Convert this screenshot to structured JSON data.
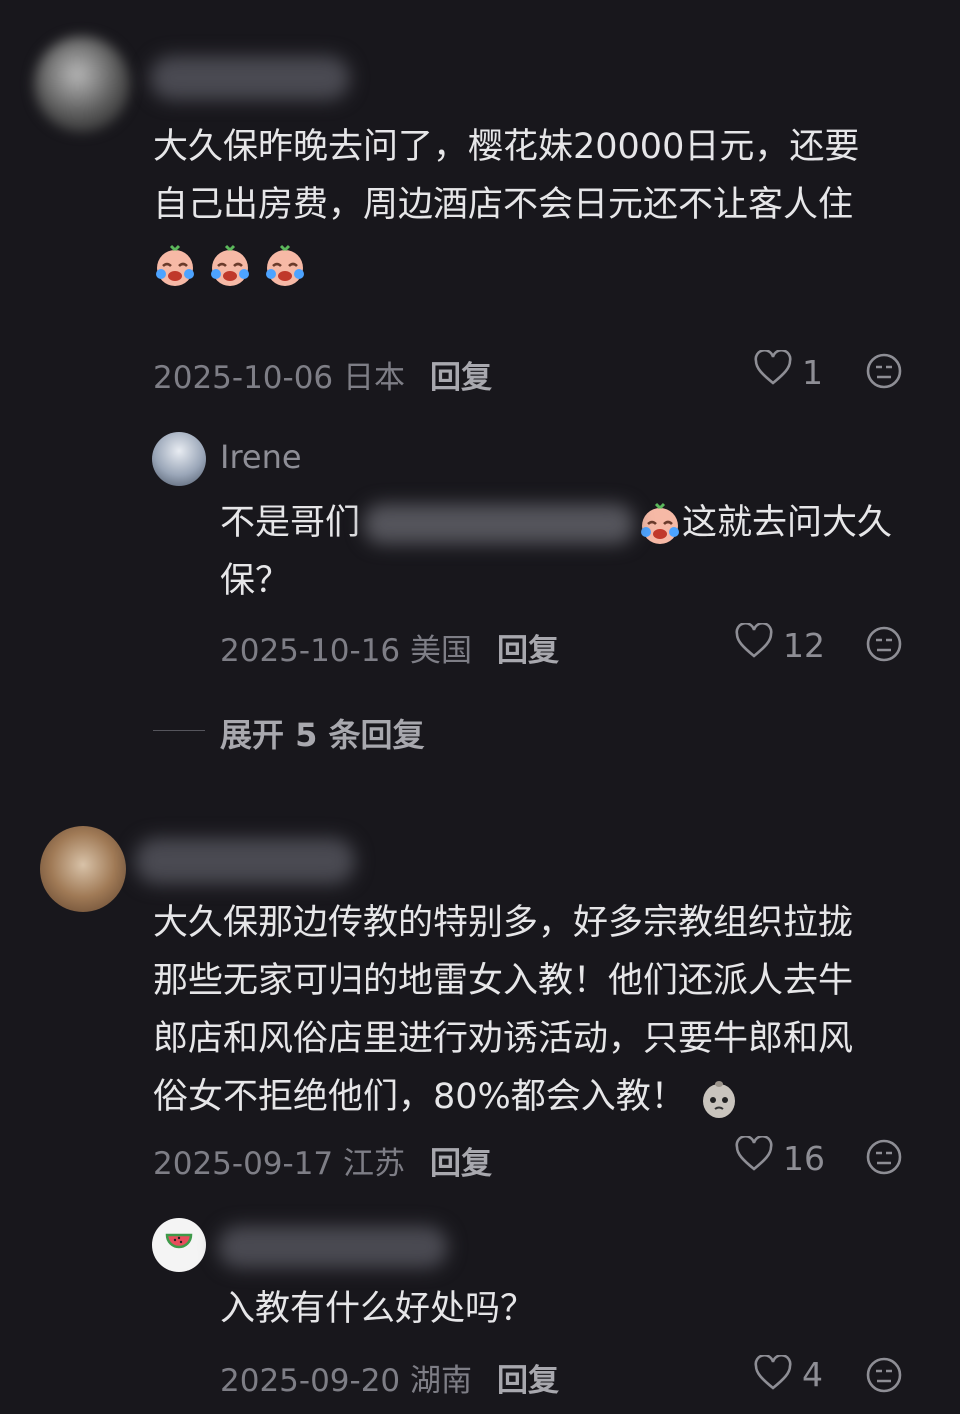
{
  "comments": [
    {
      "text_line1": "大久保昨晚去问了，樱花妹20000日元，还要",
      "text_line2": "自己出房费，周边酒店不会日元还不让客人住",
      "emoji_icon": "crying-laughing-face-icon",
      "date": "2025-10-06",
      "location": "日本",
      "reply_label": "回复",
      "likes": "1"
    },
    {
      "text_line1": "大久保那边传教的特别多，好多宗教组织拉拢",
      "text_line2": "那些无家可归的地雷女入教！他们还派人去牛",
      "text_line3": "郎店和风俗店里进行劝诱活动，只要牛郎和风",
      "text_line4": "俗女不拒绝他们，80%都会入教！",
      "emoji_icon": "potato-face-icon",
      "date": "2025-09-17",
      "location": "江苏",
      "reply_label": "回复",
      "likes": "16"
    }
  ],
  "replies": [
    {
      "username": "Irene",
      "text_prefix": "不是哥们",
      "text_suffix": "这就去问大久",
      "text_line2": "保？",
      "date": "2025-10-16",
      "location": "美国",
      "reply_label": "回复",
      "likes": "12"
    },
    {
      "text": "入教有什么好处吗？",
      "date": "2025-09-20",
      "location": "湖南",
      "reply_label": "回复",
      "likes": "4"
    }
  ],
  "expand_label": "展开 5 条回复",
  "colors": {
    "background": "#18171c",
    "text": "#e6e6e8",
    "meta": "#7e7e86"
  }
}
